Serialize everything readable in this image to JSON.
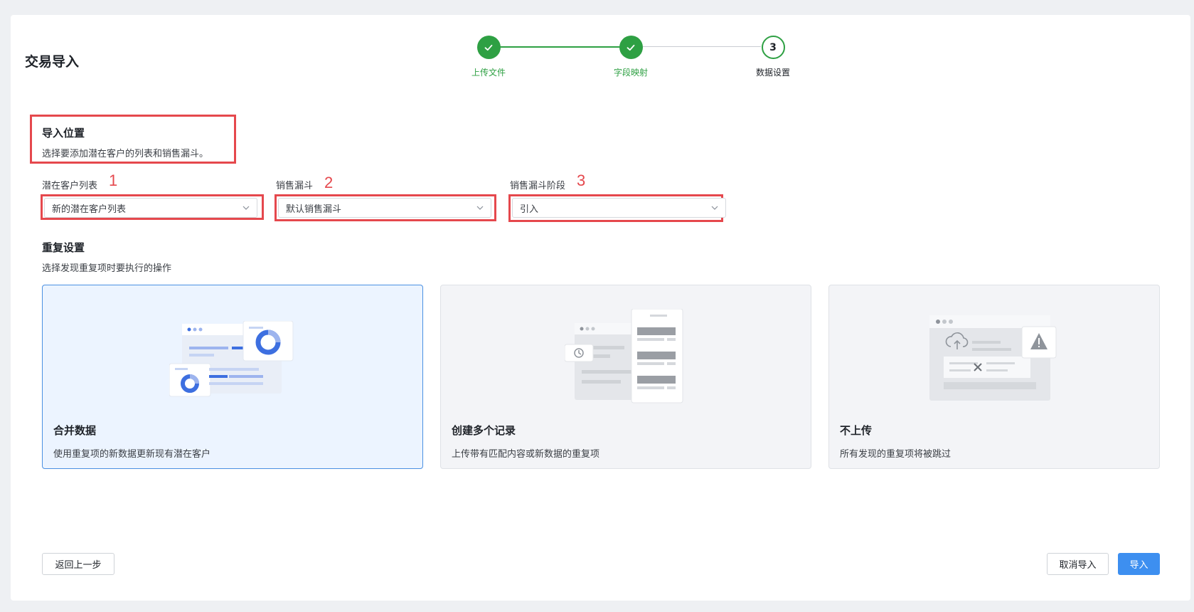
{
  "page": {
    "title": "交易导入"
  },
  "stepper": {
    "steps": [
      {
        "label": "上传文件",
        "state": "done"
      },
      {
        "label": "字段映射",
        "state": "done"
      },
      {
        "label": "数据设置",
        "state": "active",
        "number": "3"
      }
    ]
  },
  "import_location": {
    "title": "导入位置",
    "description": "选择要添加潜在客户的列表和销售漏斗。",
    "fields": [
      {
        "label": "潜在客户列表",
        "annotation": "1",
        "value": "新的潜在客户列表"
      },
      {
        "label": "销售漏斗",
        "annotation": "2",
        "value": "默认销售漏斗"
      },
      {
        "label": "销售漏斗阶段",
        "annotation": "3",
        "value": "引入"
      }
    ]
  },
  "duplicate_settings": {
    "title": "重复设置",
    "description": "选择发现重复项时要执行的操作",
    "options": [
      {
        "title": "合并数据",
        "description": "使用重复项的新数据更新现有潜在客户",
        "selected": true
      },
      {
        "title": "创建多个记录",
        "description": "上传带有匹配内容或新数据的重复项",
        "selected": false
      },
      {
        "title": "不上传",
        "description": "所有发现的重复项将被跳过",
        "selected": false
      }
    ]
  },
  "footer": {
    "back_label": "返回上一步",
    "cancel_label": "取消导入",
    "import_label": "导入"
  },
  "colors": {
    "success": "#2ea043",
    "primary": "#3d8ff0",
    "annotation_red": "#e5484d",
    "selected_card_bg": "#ecf4ff"
  }
}
